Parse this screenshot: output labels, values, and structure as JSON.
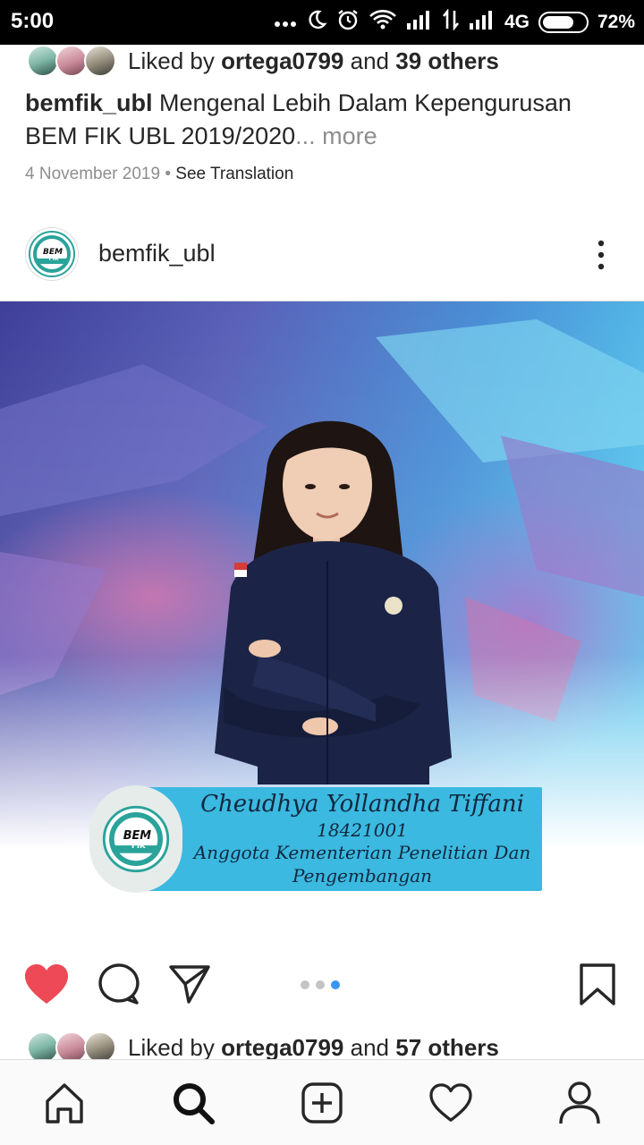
{
  "status_bar": {
    "time": "5:00",
    "network": "4G",
    "battery": "72%",
    "icons": [
      "more-dots-icon",
      "moon-icon",
      "alarm-icon",
      "wifi-icon",
      "signal-icon",
      "data-transfer-icon",
      "signal-icon",
      "battery-icon"
    ]
  },
  "previous_post": {
    "liked_prefix": "Liked by",
    "liked_user": "ortega0799",
    "liked_and": "and",
    "liked_others": "39 others",
    "caption_user": "bemfik_ubl",
    "caption_text": "Mengenal Lebih Dalam Kepengurusan BEM FIK UBL 2019/2020",
    "caption_more": "... more",
    "date": "4 November 2019",
    "separator": "•",
    "see_translation": "See Translation"
  },
  "post": {
    "username": "bemfik_ubl",
    "logo_text": "BEM FIK",
    "card": {
      "name": "Cheudhya Yollandha Tiffani",
      "student_id": "18421001",
      "role_line1": "Anggota Kementerian Penelitian Dan",
      "role_line2": "Pengembangan"
    },
    "carousel": {
      "count": 3,
      "active_index": 2
    },
    "liked_prefix": "Liked by",
    "liked_user": "ortega0799",
    "liked_and": "and",
    "liked_others": "57 others",
    "liked": true
  },
  "colors": {
    "heart": "#ed4956",
    "carousel_active": "#3897f0",
    "card_bg": "#3bb9e0",
    "text": "#262626",
    "muted": "#8e8e8e"
  },
  "bottom_nav": [
    "home-icon",
    "search-icon",
    "add-post-icon",
    "activity-heart-icon",
    "profile-icon"
  ]
}
